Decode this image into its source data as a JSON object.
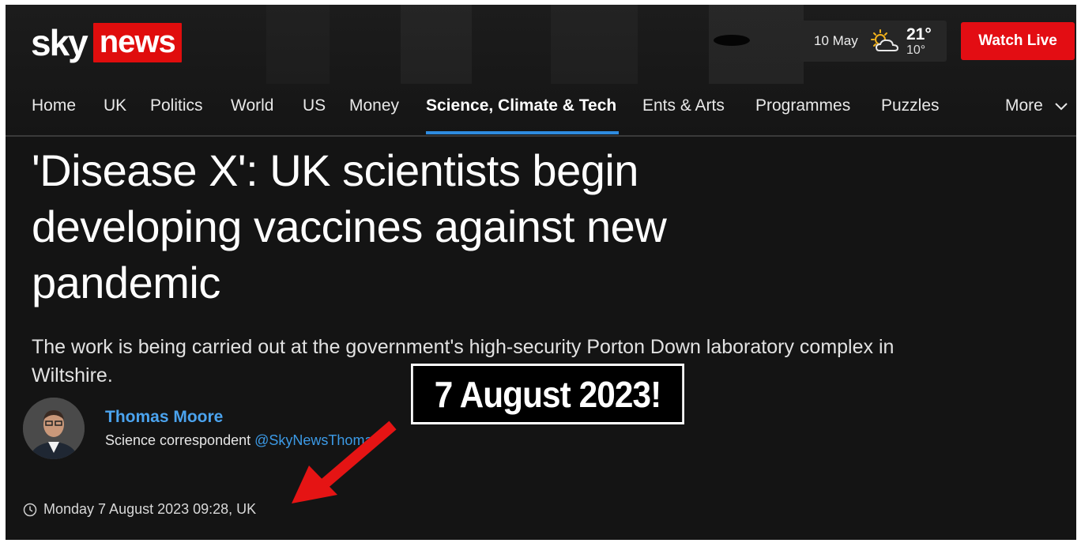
{
  "brand": {
    "sky": "sky",
    "news": "news",
    "accent": "#e00d0d"
  },
  "weather": {
    "date": "10 May",
    "high": "21°",
    "low": "10°",
    "icon": "sun-cloud-icon"
  },
  "header": {
    "watch_live": "Watch Live"
  },
  "nav": {
    "items": [
      "Home",
      "UK",
      "Politics",
      "World",
      "US",
      "Money",
      "Science, Climate & Tech",
      "Ents & Arts",
      "Programmes",
      "Puzzles"
    ],
    "active": "Science, Climate & Tech",
    "more": "More"
  },
  "article": {
    "headline": "'Disease X': UK scientists begin developing vaccines against new pandemic",
    "standfirst": "The work is being carried out at the government's high-security Porton Down laboratory complex in Wiltshire.",
    "author": {
      "name": "Thomas Moore",
      "role": "Science correspondent",
      "handle": "@SkyNewsThomas"
    },
    "timestamp": "Monday 7 August 2023 09:28, UK"
  },
  "annotation": {
    "callout": "7 August 2023!",
    "arrow_color": "#e51414"
  }
}
